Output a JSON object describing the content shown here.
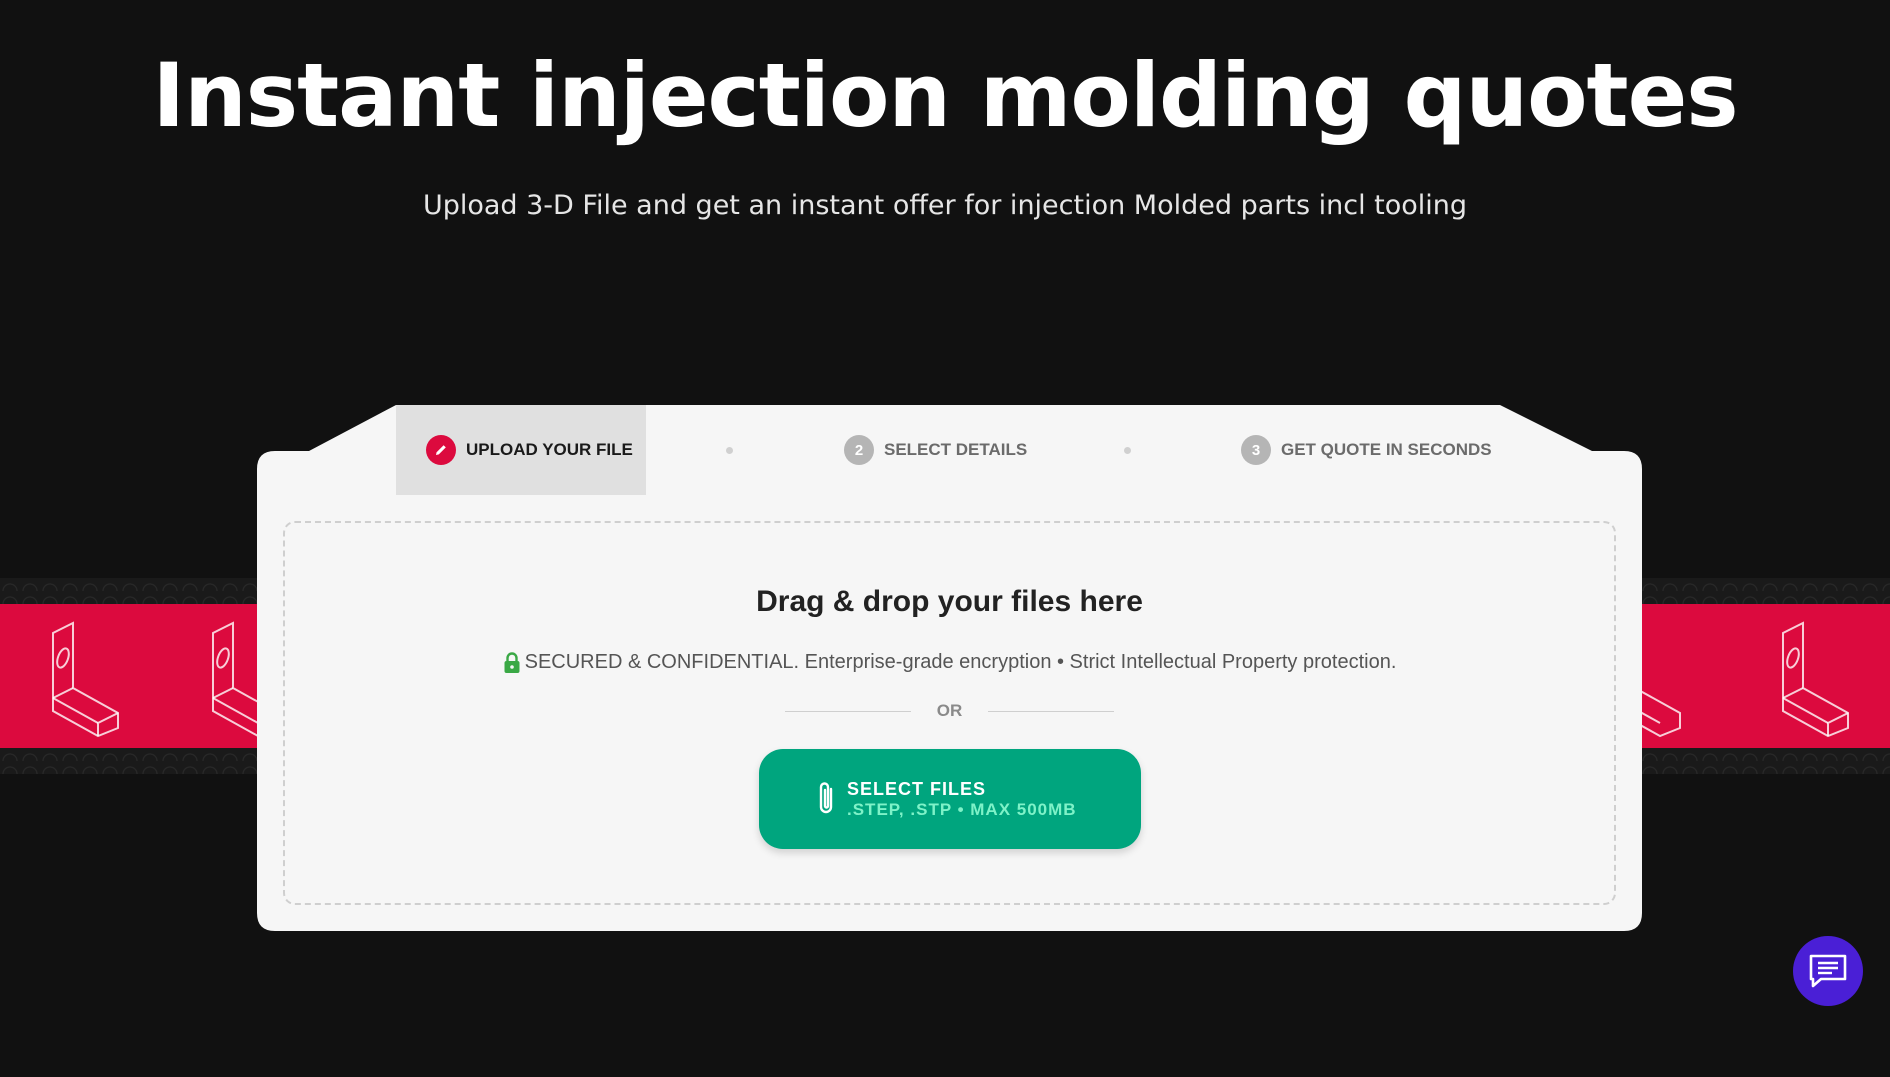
{
  "hero": {
    "title": "Instant injection molding quotes",
    "subtitle": "Upload 3-D File and get an instant offer for injection Molded parts incl tooling"
  },
  "steps": [
    {
      "label": "UPLOAD YOUR FILE",
      "icon": "pencil-icon",
      "active": true
    },
    {
      "number": "2",
      "label": "SELECT DETAILS",
      "active": false
    },
    {
      "number": "3",
      "label": "GET QUOTE IN SECONDS",
      "active": false
    }
  ],
  "dropzone": {
    "title": "Drag & drop your files here",
    "secure_text": "SECURED & CONFIDENTIAL. Enterprise-grade encryption • Strict Intellectual Property protection.",
    "or_text": "OR",
    "button_label": "SELECT FILES",
    "button_sublabel": ".STEP, .STP • MAX 500MB"
  },
  "colors": {
    "background": "#111111",
    "accent_red": "#dc0a3e",
    "button_green": "#00a57e",
    "chat_purple": "#4a1fd6",
    "lock_green": "#3aa845"
  },
  "icons": [
    "pencil-icon",
    "lock-icon",
    "paperclip-icon",
    "chat-icon",
    "bracket-icon"
  ]
}
